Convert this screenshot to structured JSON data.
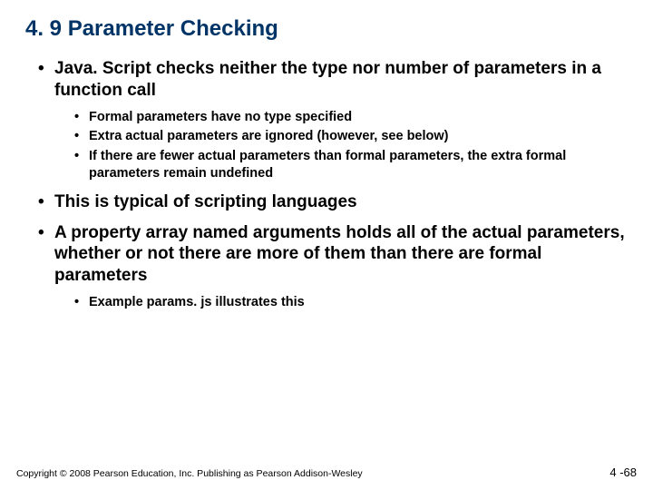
{
  "title": "4. 9 Parameter Checking",
  "bullets": [
    {
      "text": "Java. Script checks neither the type nor number of parameters in a function call",
      "sub": [
        "Formal parameters have no type specified",
        "Extra actual parameters are ignored (however, see below)",
        "If there are fewer actual parameters than formal parameters, the extra formal parameters remain undefined"
      ]
    },
    {
      "text": "This is typical of scripting languages",
      "sub": []
    },
    {
      "text": "A property array named arguments holds all of the actual parameters, whether or not there are more of them than there are formal parameters",
      "sub": [
        "Example params. js illustrates this"
      ]
    }
  ],
  "footer": {
    "copyright": "Copyright © 2008 Pearson Education, Inc. Publishing as Pearson Addison-Wesley",
    "page": "4 -68"
  }
}
